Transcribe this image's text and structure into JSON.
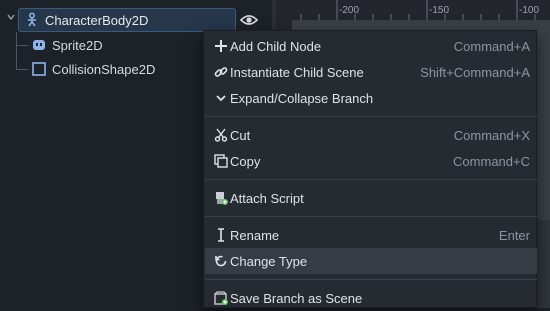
{
  "scene_tree": {
    "root": {
      "label": "CharacterBody2D"
    },
    "children": [
      {
        "label": "Sprite2D"
      },
      {
        "label": "CollisionShape2D"
      }
    ]
  },
  "ruler": {
    "ticks": [
      "-200",
      "-150",
      "-100"
    ]
  },
  "context_menu": {
    "items": [
      {
        "label": "Add Child Node",
        "shortcut": "Command+A",
        "icon": "plus-icon"
      },
      {
        "label": "Instantiate Child Scene",
        "shortcut": "Shift+Command+A",
        "icon": "link-icon"
      },
      {
        "label": "Expand/Collapse Branch",
        "shortcut": "",
        "icon": "chevron-down-icon"
      },
      {
        "label": "Cut",
        "shortcut": "Command+X",
        "icon": "scissors-icon"
      },
      {
        "label": "Copy",
        "shortcut": "Command+C",
        "icon": "copy-icon"
      },
      {
        "label": "Attach Script",
        "shortcut": "",
        "icon": "attach-script-icon"
      },
      {
        "label": "Rename",
        "shortcut": "Enter",
        "icon": "text-cursor-icon"
      },
      {
        "label": "Change Type",
        "shortcut": "",
        "icon": "change-type-icon"
      },
      {
        "label": "Save Branch as Scene",
        "shortcut": "",
        "icon": "save-branch-icon"
      }
    ],
    "hovered": "Change Type"
  },
  "colors": {
    "accent": "#5e9fe8",
    "selection": "#26364b",
    "menu_bg": "#262b32",
    "hover": "#373c44"
  }
}
